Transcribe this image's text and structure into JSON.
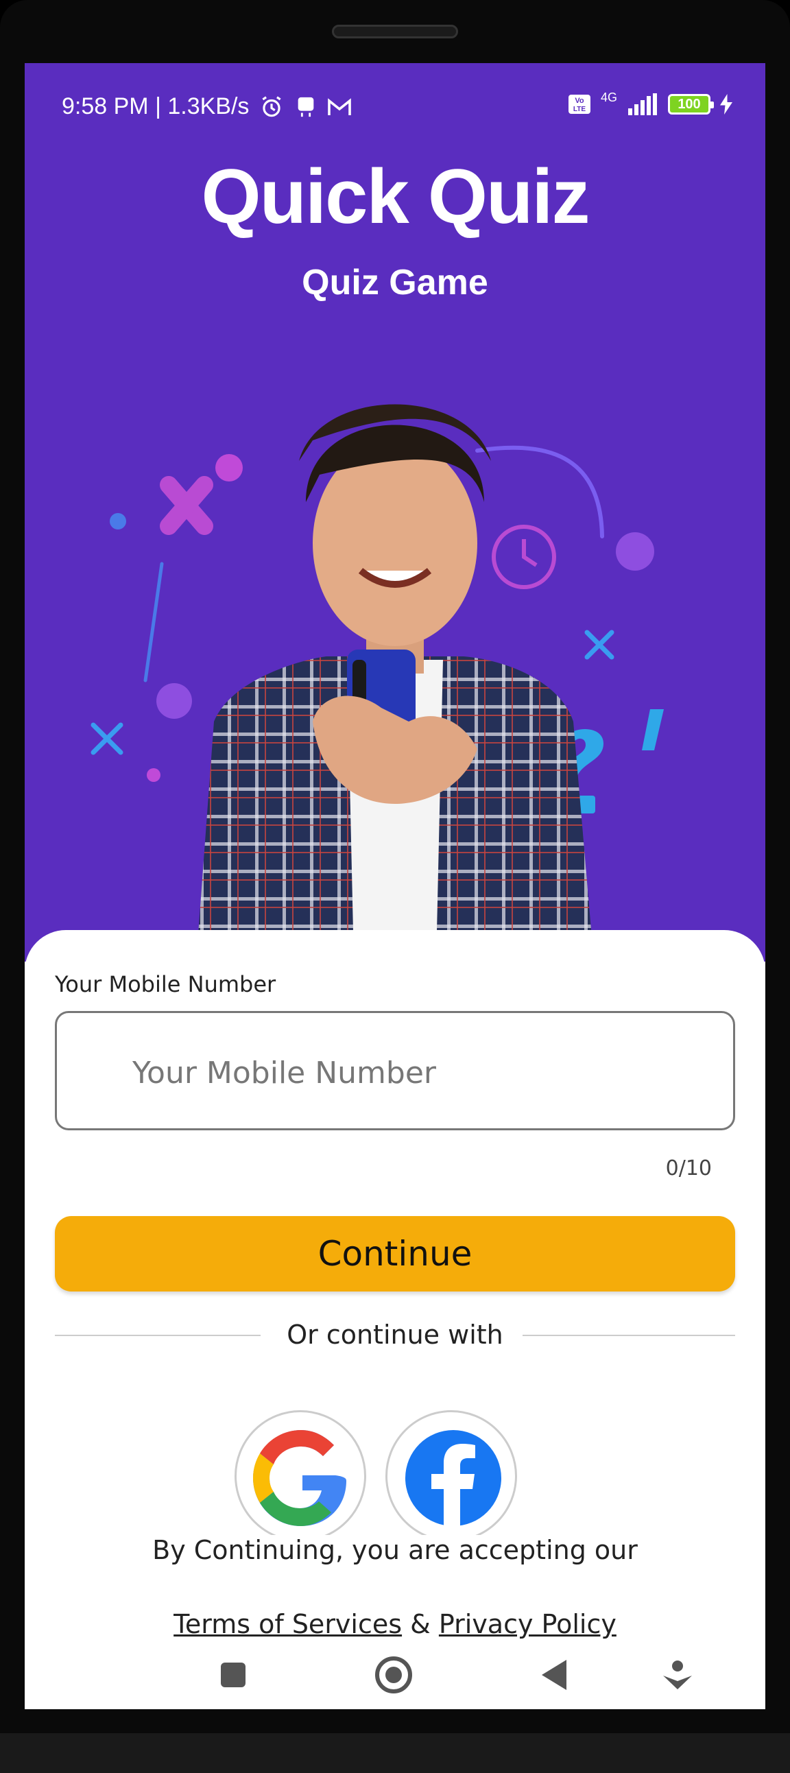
{
  "status_bar": {
    "time_speed": "9:58 PM | 1.3KB/s",
    "network": "4G",
    "battery": "100"
  },
  "app": {
    "logo_text": "Quick Quiz",
    "subtitle": "Quiz Game"
  },
  "form": {
    "field_label": "Your Mobile Number",
    "input_placeholder": "Your Mobile Number",
    "input_value": "",
    "counter": "0/10",
    "continue_label": "Continue",
    "divider_text": "Or continue with"
  },
  "social": {
    "google": "google-icon",
    "facebook": "facebook-icon"
  },
  "legal": {
    "text": "By Continuing, you are accepting our",
    "terms": "Terms of Services",
    "amp": "&",
    "privacy": "Privacy Policy"
  },
  "colors": {
    "hero_bg": "#5a2dbf",
    "accent": "#f5ac0a"
  }
}
